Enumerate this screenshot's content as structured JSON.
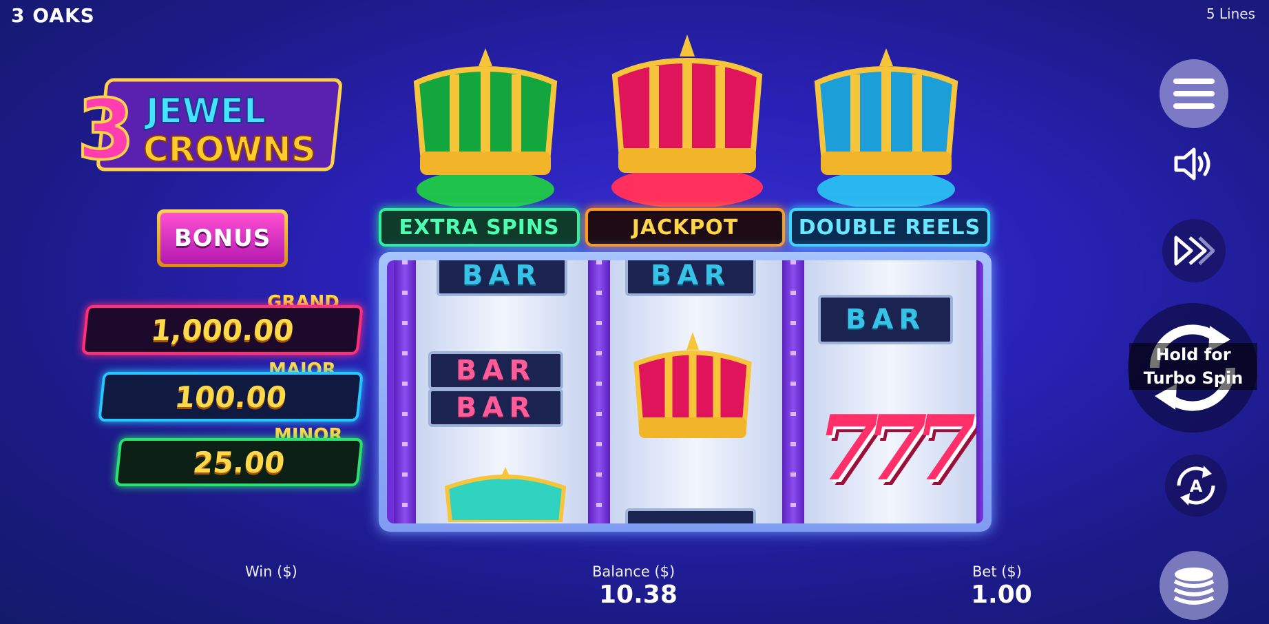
{
  "header": {
    "brand": "3 OAKS",
    "lines": "5 Lines"
  },
  "logo": {
    "number": "3",
    "line1": "JEWEL",
    "line2": "CROWNS"
  },
  "bonus_button": {
    "label": "BONUS"
  },
  "jackpots": [
    {
      "name": "GRAND",
      "value": "1,000.00",
      "color": "#ff2f7a"
    },
    {
      "name": "MAJOR",
      "value": "100.00",
      "color": "#26c6ff"
    },
    {
      "name": "MINOR",
      "value": "25.00",
      "color": "#29e26f"
    }
  ],
  "feature_tabs": [
    {
      "label": "EXTRA SPINS",
      "color": "#2ff0a0"
    },
    {
      "label": "JACKPOT",
      "color": "#ff9a1c"
    },
    {
      "label": "DOUBLE REELS",
      "color": "#3fd6ff"
    }
  ],
  "reels": {
    "reel1": [
      "BAR",
      "BAR",
      "BAR",
      "crown-teal"
    ],
    "reel2": [
      "BAR",
      "crown-red"
    ],
    "reel3": [
      "BAR",
      "777"
    ]
  },
  "controls": {
    "spin_hint_line1": "Hold for",
    "spin_hint_line2": "Turbo Spin",
    "auto_label": "A"
  },
  "footer": {
    "win_label": "Win ($)",
    "balance_label": "Balance ($)",
    "balance_value": "10.38",
    "bet_label": "Bet ($)",
    "bet_value": "1.00"
  }
}
